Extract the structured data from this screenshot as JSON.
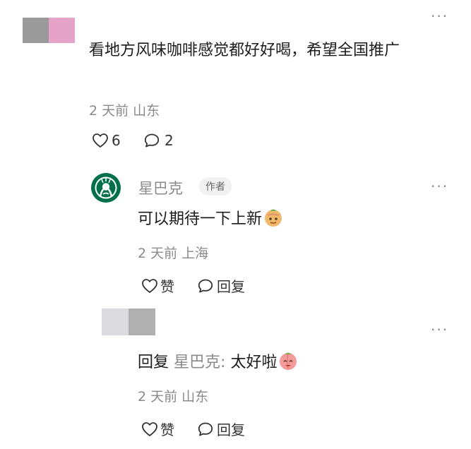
{
  "comment": {
    "text": "看地方风味咖啡感觉都好好喝，希望全国推广",
    "meta": "2 天前 山东",
    "likes": "6",
    "replies": "2",
    "avatar_colors": [
      "#9a9a9a",
      "#e6a3c8"
    ]
  },
  "reply1": {
    "author": "星巴克",
    "badge": "作者",
    "text": "可以期待一下上新",
    "emoji": "peach-sneaky-emoji",
    "meta": "2 天前 上海",
    "like_label": "赞",
    "reply_label": "回复",
    "brand_color": "#00704A"
  },
  "reply2": {
    "reply_prefix": "回复",
    "mention": "星巴克:",
    "text": "太好啦",
    "emoji": "peach-happy-emoji",
    "meta": "2 天前 山东",
    "like_label": "赞",
    "reply_label": "回复",
    "avatar_colors": [
      "#dcdce0",
      "#b0b0b0"
    ]
  },
  "icons": {
    "more": "more-icon",
    "heart": "heart-icon",
    "comment": "comment-bubble-icon"
  }
}
